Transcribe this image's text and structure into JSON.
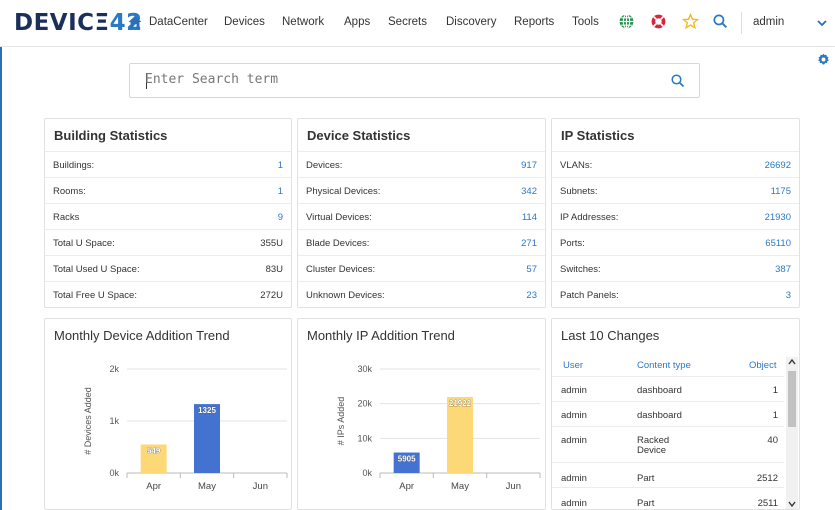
{
  "nav": {
    "logo_left": "DEVIC",
    "logo_mid": "Ξ",
    "logo_right": "42",
    "items": [
      "DataCenter",
      "Devices",
      "Network",
      "Apps",
      "Secrets",
      "Discovery",
      "Reports",
      "Tools"
    ],
    "user": "admin"
  },
  "search": {
    "placeholder": "Enter Search term"
  },
  "building": {
    "title": "Building Statistics",
    "rows": [
      {
        "label": "Buildings:",
        "value": "1"
      },
      {
        "label": "Rooms:",
        "value": "1"
      },
      {
        "label": "Racks",
        "value": "9"
      },
      {
        "label": "Total U Space:",
        "value": "355U"
      },
      {
        "label": "Total Used U Space:",
        "value": "83U"
      },
      {
        "label": "Total Free U Space:",
        "value": "272U"
      }
    ]
  },
  "device": {
    "title": "Device Statistics",
    "rows": [
      {
        "label": "Devices:",
        "value": "917"
      },
      {
        "label": "Physical Devices:",
        "value": "342"
      },
      {
        "label": "Virtual Devices:",
        "value": "114"
      },
      {
        "label": "Blade Devices:",
        "value": "271"
      },
      {
        "label": "Cluster Devices:",
        "value": "57"
      },
      {
        "label": "Unknown Devices:",
        "value": "23"
      }
    ]
  },
  "ip": {
    "title": "IP Statistics",
    "rows": [
      {
        "label": "VLANs:",
        "value": "26692"
      },
      {
        "label": "Subnets:",
        "value": "1175"
      },
      {
        "label": "IP Addresses:",
        "value": "21930"
      },
      {
        "label": "Ports:",
        "value": "65110"
      },
      {
        "label": "Switches:",
        "value": "387"
      },
      {
        "label": "Patch Panels:",
        "value": "3"
      }
    ]
  },
  "device_trend_title": "Monthly Device Addition Trend",
  "ip_trend_title": "Monthly IP Addition Trend",
  "changes": {
    "title": "Last 10 Changes",
    "headers": [
      "User",
      "Content type",
      "Object"
    ],
    "rows": [
      [
        "admin",
        "dashboard",
        "1"
      ],
      [
        "admin",
        "dashboard",
        "1"
      ],
      [
        "admin",
        "Racked Device",
        "40"
      ],
      [
        "admin",
        "Part",
        "2512"
      ],
      [
        "admin",
        "Part",
        "2511"
      ]
    ]
  },
  "colors": {
    "accent": "#2a78c6",
    "bar_yellow": "#fcd877",
    "bar_blue": "#4472d1"
  },
  "chart_data": [
    {
      "type": "bar",
      "categories": [
        "Apr",
        "May",
        "Jun"
      ],
      "values": [
        549,
        1325,
        0
      ],
      "colors": [
        "#fcd877",
        "#4472d1",
        "#fcd877"
      ],
      "title": "Monthly Device Addition Trend",
      "xlabel": "",
      "ylabel": "# Devices Added",
      "yticks": [
        "0k",
        "1k",
        "2k"
      ],
      "ylim": [
        0,
        2000
      ],
      "data_labels": true
    },
    {
      "type": "bar",
      "categories": [
        "Apr",
        "May",
        "Jun"
      ],
      "values": [
        5905,
        21922,
        0
      ],
      "colors": [
        "#4472d1",
        "#fcd877",
        "#4472d1"
      ],
      "title": "Monthly IP Addition Trend",
      "xlabel": "",
      "ylabel": "# IPs Added",
      "yticks": [
        "0k",
        "10k",
        "20k",
        "30k"
      ],
      "ylim": [
        0,
        30000
      ],
      "data_labels": true
    }
  ]
}
